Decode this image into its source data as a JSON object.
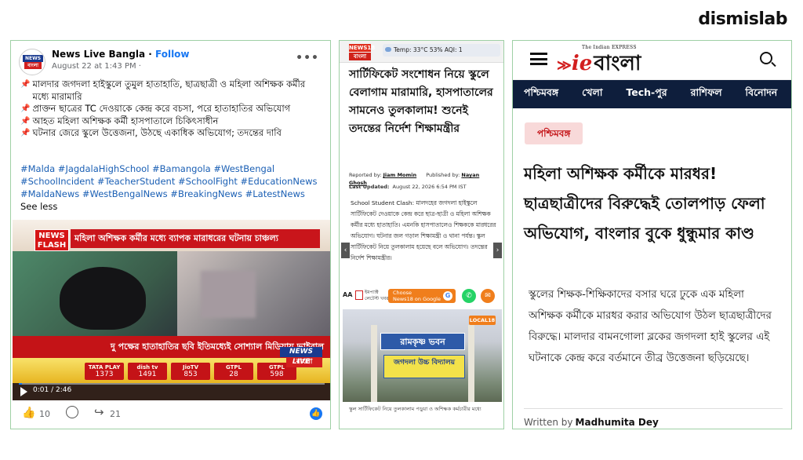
{
  "brand": "dismislab",
  "facebook": {
    "page_name": "News Live Bangla",
    "follow": "Follow",
    "dot": " · ",
    "timestamp": "August 22 at 1:43 PM ·",
    "more": "•••",
    "avatar_top": "NEWS LIVE",
    "avatar_bottom": "বাংলা",
    "post_lines": [
      "মালদার জগদলা হাইস্কুলে তুমুল হাতাহাতি, ছাত্রছাত্রী ও মহিলা অশিক্ষক কর্মীর মধ্যে মারামারি",
      "প্রাক্তন ছাত্রের TC দেওয়াকে কেন্দ্র করে বচসা, পরে হাতাহাতির অভিযোগ",
      "আহত মহিলা অশিক্ষক কর্মী হাসপাতালে চিকিৎসাধীন",
      "ঘটনার জেরে স্কুলে উত্তেজনা, উঠছে একাধিক অভিযোগ; তদন্তের দাবি"
    ],
    "hashtags": "#Malda #JagdalaHighSchool #Bamangola #WestBengal #SchoolIncident #TeacherStudent #SchoolFight #EducationNews #MaldaNews #WestBengalNews #BreakingNews #LatestNews",
    "see_more": "See less",
    "video": {
      "flash": "NEWS FLASH",
      "headline": "মহিলা অশিক্ষক কর্মীর মধ্যে ব্যাপক মারাধরের ঘটনায় চাঞ্চল্য",
      "ticker": "দু পক্ষের হাতাহাতির ছবি ইতিমধ্যেই সোশ্যাল মিডিয়ায় ভাইরাল",
      "time": "0:01 / 2:46",
      "progress": 0.01,
      "channels": [
        {
          "name": "TATA PLAY",
          "num": "1373"
        },
        {
          "name": "dish tv",
          "num": "1491"
        },
        {
          "name": "JioTV",
          "num": "853"
        },
        {
          "name": "GTPL",
          "num": "28"
        },
        {
          "name": "GTPL",
          "num": "598"
        }
      ],
      "logo_top": "NEWS LIVE",
      "logo_bottom": "বাংলা"
    },
    "likes": "10",
    "shares": "21"
  },
  "news18": {
    "logo_top": "NEWS18",
    "logo_bottom": "বাংলা",
    "weather": "Temp: 33°C   53%     AQI: 1",
    "headline": "সার্টিফিকেট সংশোধন নিয়ে স্কুলে বেলাগাম মারামারি, হাসপাতালের সামনেও তুলকালাম! শুনেই তদন্তের নির্দেশ শিক্ষামন্ত্রীর",
    "reported_label": "Reported by:",
    "reporter": "Jiam Momin",
    "published_label": "Published by:",
    "publisher": "Nayan Ghosh",
    "updated_label": "Last Updated:",
    "updated": "August 22, 2026 6:54 PM IST",
    "body": "School Student Clash: মালদহের জগদলা হাইস্কুলে সার্টিফিকেট দেওয়াকে কেন্দ্র করে ছাত্র-ছাত্রী ও মহিলা অশিক্ষক কর্মীর মধ্যে হাতাহাতি। এমনকি হাসপাতালেও শিক্ষককে মারধরের অভিযোগ। ঘটনার জল গড়াল শিক্ষামন্ত্রী ও থানা পর্যন্ত। স্কুল সার্টিফিকেট নিয়ে তুলকালাম হয়েছে বলে অভিযোগ। তদন্তের নির্দেশ শিক্ষামন্ত্রীর।",
    "aa": "AA",
    "small_top": "ইমপ্যাক্ট",
    "small_bottom": "লেটেস্ট খবর",
    "google_top": "Choose",
    "google_bottom": "News18 on Google",
    "photo_sign_1": "রামকৃষ্ণ ভবন",
    "photo_sign_2": "জগদলা উচ্চ বিদ্যালয়",
    "photo_local": "LOCAL18",
    "caption": "স্কুল সার্টিফিকেট নিয়ে তুলকালাম পড়ুয়া ও অশিক্ষক কর্মচারীর মধ্যে"
  },
  "iebangla": {
    "tagline": "The Indian EXPRESS",
    "logo_ie": "ie",
    "logo_text": "বাংলা",
    "nav": [
      "পশ্চিমবঙ্গ",
      "খেলা",
      "Tech-পুর",
      "রাশিফল",
      "বিনোদন"
    ],
    "category": "পশ্চিমবঙ্গ",
    "headline": "মহিলা অশিক্ষক কর্মীকে মারধর! ছাত্রছাত্রীদের বিরুদ্ধেই তোলপাড় ফেলা অভিযোগ, বাংলার বুকে ধুন্ধুমার কাণ্ড",
    "lead": "স্কুলের শিক্ষক-শিক্ষিকাদের বসার ঘরে ঢুকে এক মহিলা অশিক্ষক কর্মীকে মারধর করার অভিযোগ উঠল ছাত্রছাত্রীদের বিরুদ্ধে। মালদার বামনগোলা ব্লকের জগদলা হাই স্কুলের এই ঘটনাকে কেন্দ্র করে বর্তমানে তীব্র উত্তেজনা ছড়িয়েছে।",
    "written_by": "Written by",
    "author": "Madhumita Dey"
  }
}
